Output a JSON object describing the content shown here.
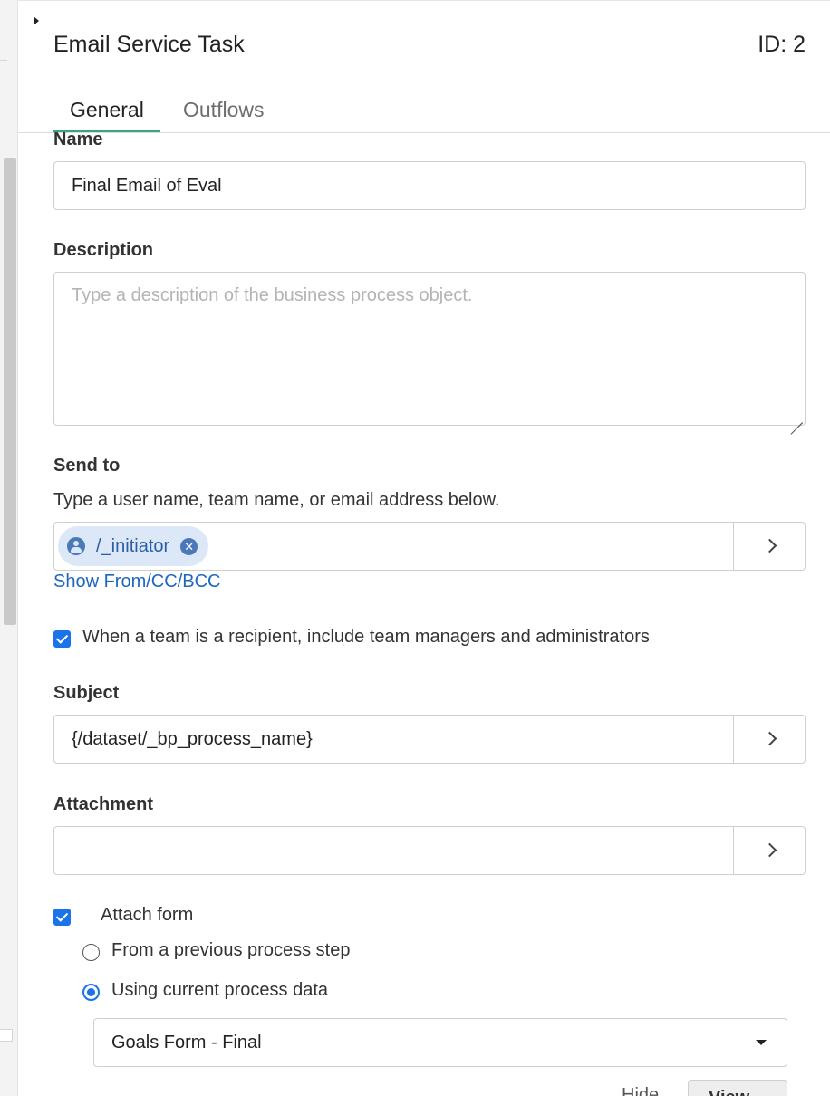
{
  "panel": {
    "title": "Email Service Task",
    "id_label": "ID: 2"
  },
  "tabs": [
    {
      "label": "General",
      "active": true
    },
    {
      "label": "Outflows",
      "active": false
    }
  ],
  "name_field": {
    "label": "Name",
    "value": "Final Email of Eval"
  },
  "description_field": {
    "label": "Description",
    "placeholder": "Type a description of the business process object.",
    "value": ""
  },
  "send_to": {
    "label": "Send to",
    "help": "Type a user name, team name, or email address below.",
    "recipients": [
      {
        "label": "/_initiator",
        "icon": "user-icon"
      }
    ],
    "show_from_link": "Show From/CC/BCC"
  },
  "team_checkbox": {
    "label": "When a team is a recipient, include team managers and administrators",
    "checked": true
  },
  "subject_field": {
    "label": "Subject",
    "value": "{/dataset/_bp_process_name}"
  },
  "attachment_field": {
    "label": "Attachment",
    "value": ""
  },
  "attach_form": {
    "label": "Attach form",
    "checked": true,
    "options": [
      {
        "label": "From a previous process step",
        "selected": false
      },
      {
        "label": "Using current process data",
        "selected": true
      }
    ],
    "form_select": "Goals Form - Final"
  },
  "footer_partial": {
    "text": "Hide",
    "button": "View"
  },
  "colors": {
    "accent": "#3aa57a",
    "link": "#1f66c2",
    "checkbox": "#1a73e8",
    "pill_bg": "#dce8f7"
  }
}
